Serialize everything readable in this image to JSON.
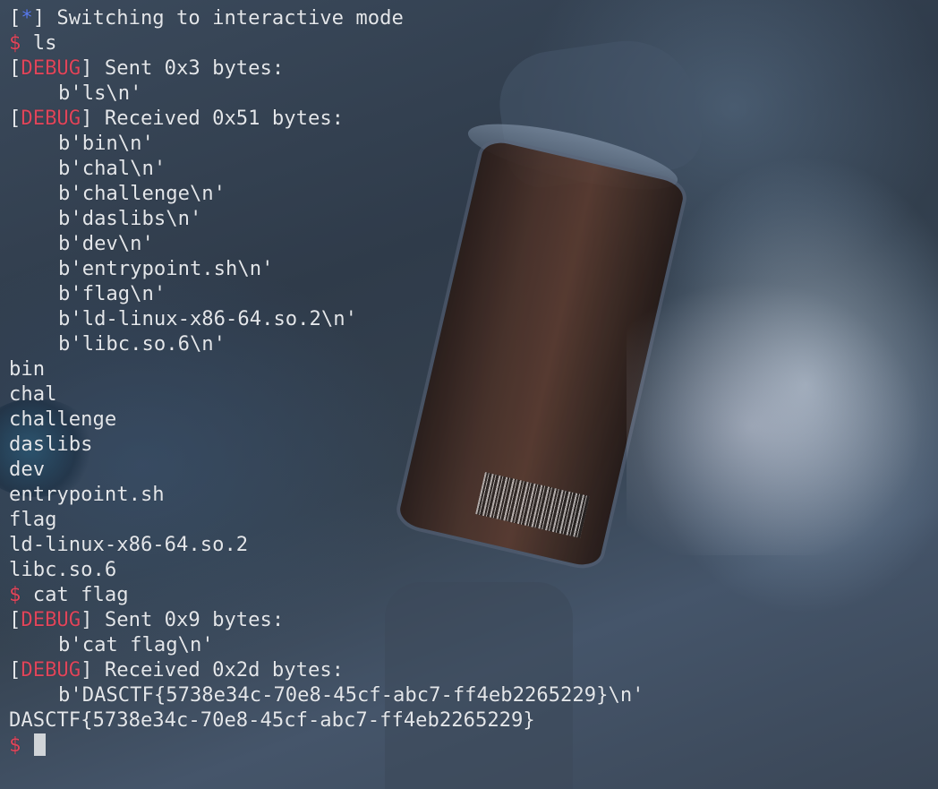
{
  "terminal": {
    "lines": [
      {
        "kind": "info",
        "open": "[",
        "star": "*",
        "close": "]",
        "text": " Switching to interactive mode"
      },
      {
        "kind": "prompt",
        "sign": "$",
        "text": " ls"
      },
      {
        "kind": "debug",
        "open": "[",
        "tag": "DEBUG",
        "close": "]",
        "text": " Sent 0x3 bytes:"
      },
      {
        "kind": "indent",
        "text": "b'ls\\n'"
      },
      {
        "kind": "debug",
        "open": "[",
        "tag": "DEBUG",
        "close": "]",
        "text": " Received 0x51 bytes:"
      },
      {
        "kind": "indent",
        "text": "b'bin\\n'"
      },
      {
        "kind": "indent",
        "text": "b'chal\\n'"
      },
      {
        "kind": "indent",
        "text": "b'challenge\\n'"
      },
      {
        "kind": "indent",
        "text": "b'daslibs\\n'"
      },
      {
        "kind": "indent",
        "text": "b'dev\\n'"
      },
      {
        "kind": "indent",
        "text": "b'entrypoint.sh\\n'"
      },
      {
        "kind": "indent",
        "text": "b'flag\\n'"
      },
      {
        "kind": "indent",
        "text": "b'ld-linux-x86-64.so.2\\n'"
      },
      {
        "kind": "indent",
        "text": "b'libc.so.6\\n'"
      },
      {
        "kind": "plain",
        "text": "bin"
      },
      {
        "kind": "plain",
        "text": "chal"
      },
      {
        "kind": "plain",
        "text": "challenge"
      },
      {
        "kind": "plain",
        "text": "daslibs"
      },
      {
        "kind": "plain",
        "text": "dev"
      },
      {
        "kind": "plain",
        "text": "entrypoint.sh"
      },
      {
        "kind": "plain",
        "text": "flag"
      },
      {
        "kind": "plain",
        "text": "ld-linux-x86-64.so.2"
      },
      {
        "kind": "plain",
        "text": "libc.so.6"
      },
      {
        "kind": "prompt",
        "sign": "$",
        "text": " cat flag"
      },
      {
        "kind": "debug",
        "open": "[",
        "tag": "DEBUG",
        "close": "]",
        "text": " Sent 0x9 bytes:"
      },
      {
        "kind": "indent",
        "text": "b'cat flag\\n'"
      },
      {
        "kind": "debug",
        "open": "[",
        "tag": "DEBUG",
        "close": "]",
        "text": " Received 0x2d bytes:"
      },
      {
        "kind": "indent",
        "text": "b'DASCTF{5738e34c-70e8-45cf-abc7-ff4eb2265229}\\n'"
      },
      {
        "kind": "plain",
        "text": "DASCTF{5738e34c-70e8-45cf-abc7-ff4eb2265229}"
      },
      {
        "kind": "input",
        "sign": "$",
        "text": " "
      }
    ]
  },
  "colors": {
    "text": "#e3e6ea",
    "prompt_sign": "#e0455a",
    "debug_tag": "#e0455a",
    "info_star": "#5a7cf0",
    "cursor": "#d0d4d8"
  }
}
